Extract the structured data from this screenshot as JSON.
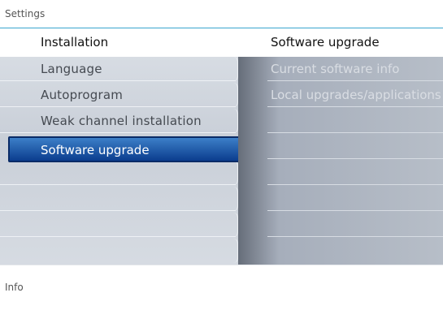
{
  "window": {
    "title": "Settings"
  },
  "header": {
    "left_title": "Installation",
    "right_title": "Software upgrade"
  },
  "left_menu": {
    "items": [
      "Language",
      "Autoprogram",
      "Weak channel installation",
      "Software upgrade"
    ],
    "selected_index": 3
  },
  "right_menu": {
    "items": [
      "Current software info",
      "Local upgrades/applications"
    ]
  },
  "footer": {
    "label": "Info"
  }
}
